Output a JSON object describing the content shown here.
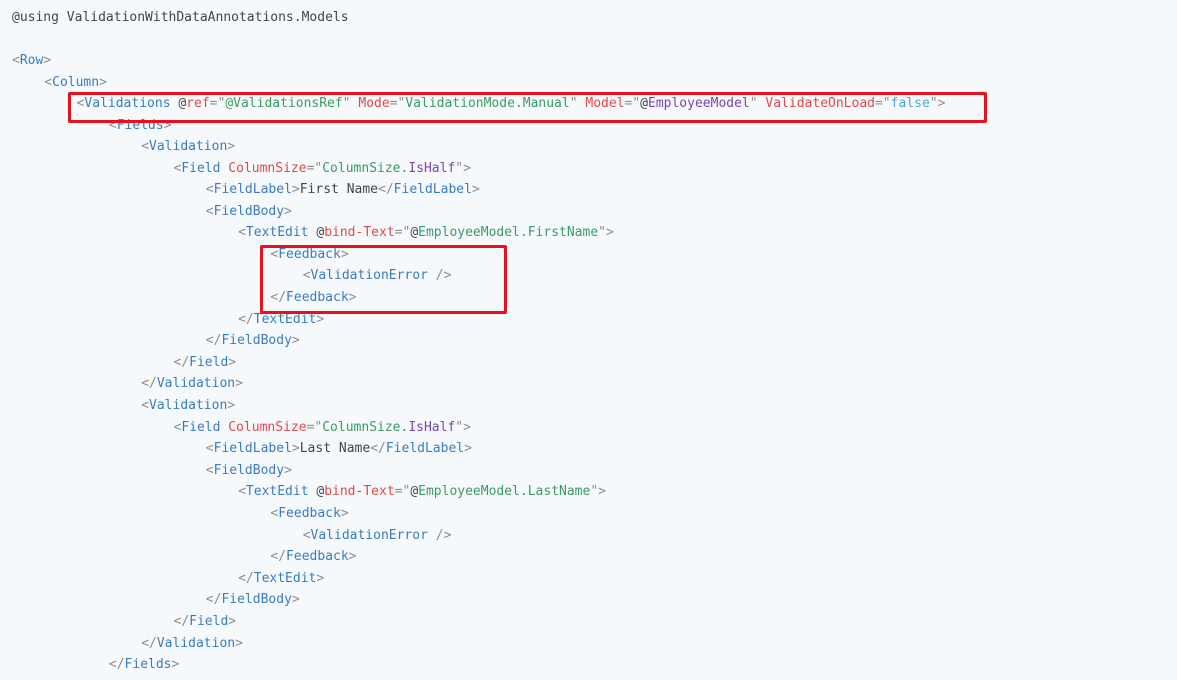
{
  "code_lines": [
    {
      "indent": 0,
      "tokens": [
        {
          "t": "text",
          "v": "@using ValidationWithDataAnnotations.Models"
        }
      ]
    },
    {
      "indent": 0,
      "tokens": []
    },
    {
      "indent": 0,
      "tokens": [
        {
          "t": "punct",
          "v": "<"
        },
        {
          "t": "tag",
          "v": "Row"
        },
        {
          "t": "punct",
          "v": ">"
        }
      ]
    },
    {
      "indent": 1,
      "tokens": [
        {
          "t": "punct",
          "v": "<"
        },
        {
          "t": "tag",
          "v": "Column"
        },
        {
          "t": "punct",
          "v": ">"
        }
      ]
    },
    {
      "indent": 2,
      "tokens": [
        {
          "t": "punct",
          "v": "<"
        },
        {
          "t": "tag",
          "v": "Validations"
        },
        {
          "t": "text",
          "v": " @"
        },
        {
          "t": "attr",
          "v": "ref"
        },
        {
          "t": "punct",
          "v": "=\""
        },
        {
          "t": "str",
          "v": "@ValidationsRef"
        },
        {
          "t": "punct",
          "v": "\""
        },
        {
          "t": "text",
          "v": " "
        },
        {
          "t": "attr",
          "v": "Mode"
        },
        {
          "t": "punct",
          "v": "=\""
        },
        {
          "t": "str",
          "v": "ValidationMode.Manual"
        },
        {
          "t": "punct",
          "v": "\""
        },
        {
          "t": "text",
          "v": " "
        },
        {
          "t": "attr",
          "v": "Model"
        },
        {
          "t": "punct",
          "v": "=\""
        },
        {
          "t": "text",
          "v": "@"
        },
        {
          "t": "val",
          "v": "EmployeeModel"
        },
        {
          "t": "punct",
          "v": "\""
        },
        {
          "t": "text",
          "v": " "
        },
        {
          "t": "attr",
          "v": "ValidateOnLoad"
        },
        {
          "t": "punct",
          "v": "=\""
        },
        {
          "t": "kw",
          "v": "false"
        },
        {
          "t": "punct",
          "v": "\">"
        }
      ]
    },
    {
      "indent": 3,
      "tokens": [
        {
          "t": "punct",
          "v": "<"
        },
        {
          "t": "tag",
          "v": "Fields"
        },
        {
          "t": "punct",
          "v": ">"
        }
      ]
    },
    {
      "indent": 4,
      "tokens": [
        {
          "t": "punct",
          "v": "<"
        },
        {
          "t": "tag",
          "v": "Validation"
        },
        {
          "t": "punct",
          "v": ">"
        }
      ]
    },
    {
      "indent": 5,
      "tokens": [
        {
          "t": "punct",
          "v": "<"
        },
        {
          "t": "tag",
          "v": "Field"
        },
        {
          "t": "text",
          "v": " "
        },
        {
          "t": "attr",
          "v": "ColumnSize"
        },
        {
          "t": "punct",
          "v": "=\""
        },
        {
          "t": "str",
          "v": "ColumnSize."
        },
        {
          "t": "val",
          "v": "IsHalf"
        },
        {
          "t": "punct",
          "v": "\">"
        }
      ]
    },
    {
      "indent": 6,
      "tokens": [
        {
          "t": "punct",
          "v": "<"
        },
        {
          "t": "tag",
          "v": "FieldLabel"
        },
        {
          "t": "punct",
          "v": ">"
        },
        {
          "t": "text",
          "v": "First Name"
        },
        {
          "t": "punct",
          "v": "</"
        },
        {
          "t": "tag",
          "v": "FieldLabel"
        },
        {
          "t": "punct",
          "v": ">"
        }
      ]
    },
    {
      "indent": 6,
      "tokens": [
        {
          "t": "punct",
          "v": "<"
        },
        {
          "t": "tag",
          "v": "FieldBody"
        },
        {
          "t": "punct",
          "v": ">"
        }
      ]
    },
    {
      "indent": 7,
      "tokens": [
        {
          "t": "punct",
          "v": "<"
        },
        {
          "t": "tag",
          "v": "TextEdit"
        },
        {
          "t": "text",
          "v": " @"
        },
        {
          "t": "attr",
          "v": "bind-Text"
        },
        {
          "t": "punct",
          "v": "=\""
        },
        {
          "t": "text",
          "v": "@"
        },
        {
          "t": "str",
          "v": "EmployeeModel.FirstName"
        },
        {
          "t": "punct",
          "v": "\">"
        }
      ]
    },
    {
      "indent": 8,
      "tokens": [
        {
          "t": "punct",
          "v": "<"
        },
        {
          "t": "tag",
          "v": "Feedback"
        },
        {
          "t": "punct",
          "v": ">"
        }
      ]
    },
    {
      "indent": 9,
      "tokens": [
        {
          "t": "punct",
          "v": "<"
        },
        {
          "t": "tag",
          "v": "ValidationError"
        },
        {
          "t": "punct",
          "v": " />"
        }
      ]
    },
    {
      "indent": 8,
      "tokens": [
        {
          "t": "punct",
          "v": "</"
        },
        {
          "t": "tag",
          "v": "Feedback"
        },
        {
          "t": "punct",
          "v": ">"
        }
      ]
    },
    {
      "indent": 7,
      "tokens": [
        {
          "t": "punct",
          "v": "</"
        },
        {
          "t": "tag",
          "v": "TextEdit"
        },
        {
          "t": "punct",
          "v": ">"
        }
      ]
    },
    {
      "indent": 6,
      "tokens": [
        {
          "t": "punct",
          "v": "</"
        },
        {
          "t": "tag",
          "v": "FieldBody"
        },
        {
          "t": "punct",
          "v": ">"
        }
      ]
    },
    {
      "indent": 5,
      "tokens": [
        {
          "t": "punct",
          "v": "</"
        },
        {
          "t": "tag",
          "v": "Field"
        },
        {
          "t": "punct",
          "v": ">"
        }
      ]
    },
    {
      "indent": 4,
      "tokens": [
        {
          "t": "punct",
          "v": "</"
        },
        {
          "t": "tag",
          "v": "Validation"
        },
        {
          "t": "punct",
          "v": ">"
        }
      ]
    },
    {
      "indent": 4,
      "tokens": [
        {
          "t": "punct",
          "v": "<"
        },
        {
          "t": "tag",
          "v": "Validation"
        },
        {
          "t": "punct",
          "v": ">"
        }
      ]
    },
    {
      "indent": 5,
      "tokens": [
        {
          "t": "punct",
          "v": "<"
        },
        {
          "t": "tag",
          "v": "Field"
        },
        {
          "t": "text",
          "v": " "
        },
        {
          "t": "attr",
          "v": "ColumnSize"
        },
        {
          "t": "punct",
          "v": "=\""
        },
        {
          "t": "str",
          "v": "ColumnSize."
        },
        {
          "t": "val",
          "v": "IsHalf"
        },
        {
          "t": "punct",
          "v": "\">"
        }
      ]
    },
    {
      "indent": 6,
      "tokens": [
        {
          "t": "punct",
          "v": "<"
        },
        {
          "t": "tag",
          "v": "FieldLabel"
        },
        {
          "t": "punct",
          "v": ">"
        },
        {
          "t": "text",
          "v": "Last Name"
        },
        {
          "t": "punct",
          "v": "</"
        },
        {
          "t": "tag",
          "v": "FieldLabel"
        },
        {
          "t": "punct",
          "v": ">"
        }
      ]
    },
    {
      "indent": 6,
      "tokens": [
        {
          "t": "punct",
          "v": "<"
        },
        {
          "t": "tag",
          "v": "FieldBody"
        },
        {
          "t": "punct",
          "v": ">"
        }
      ]
    },
    {
      "indent": 7,
      "tokens": [
        {
          "t": "punct",
          "v": "<"
        },
        {
          "t": "tag",
          "v": "TextEdit"
        },
        {
          "t": "text",
          "v": " @"
        },
        {
          "t": "attr",
          "v": "bind-Text"
        },
        {
          "t": "punct",
          "v": "=\""
        },
        {
          "t": "text",
          "v": "@"
        },
        {
          "t": "str",
          "v": "EmployeeModel.LastName"
        },
        {
          "t": "punct",
          "v": "\">"
        }
      ]
    },
    {
      "indent": 8,
      "tokens": [
        {
          "t": "punct",
          "v": "<"
        },
        {
          "t": "tag",
          "v": "Feedback"
        },
        {
          "t": "punct",
          "v": ">"
        }
      ]
    },
    {
      "indent": 9,
      "tokens": [
        {
          "t": "punct",
          "v": "<"
        },
        {
          "t": "tag",
          "v": "ValidationError"
        },
        {
          "t": "punct",
          "v": " />"
        }
      ]
    },
    {
      "indent": 8,
      "tokens": [
        {
          "t": "punct",
          "v": "</"
        },
        {
          "t": "tag",
          "v": "Feedback"
        },
        {
          "t": "punct",
          "v": ">"
        }
      ]
    },
    {
      "indent": 7,
      "tokens": [
        {
          "t": "punct",
          "v": "</"
        },
        {
          "t": "tag",
          "v": "TextEdit"
        },
        {
          "t": "punct",
          "v": ">"
        }
      ]
    },
    {
      "indent": 6,
      "tokens": [
        {
          "t": "punct",
          "v": "</"
        },
        {
          "t": "tag",
          "v": "FieldBody"
        },
        {
          "t": "punct",
          "v": ">"
        }
      ]
    },
    {
      "indent": 5,
      "tokens": [
        {
          "t": "punct",
          "v": "</"
        },
        {
          "t": "tag",
          "v": "Field"
        },
        {
          "t": "punct",
          "v": ">"
        }
      ]
    },
    {
      "indent": 4,
      "tokens": [
        {
          "t": "punct",
          "v": "</"
        },
        {
          "t": "tag",
          "v": "Validation"
        },
        {
          "t": "punct",
          "v": ">"
        }
      ]
    },
    {
      "indent": 3,
      "tokens": [
        {
          "t": "punct",
          "v": "</"
        },
        {
          "t": "tag",
          "v": "Fields"
        },
        {
          "t": "punct",
          "v": ">"
        }
      ]
    }
  ],
  "highlights": [
    {
      "name": "validations-highlight-box",
      "color": "#e8101a"
    },
    {
      "name": "feedback-highlight-box",
      "color": "#e8101a"
    }
  ],
  "colors": {
    "background": "#f6f9fc",
    "text": "#444444",
    "punctuation": "#8c8c8c",
    "tag": "#3a7bc0",
    "attribute": "#e44848",
    "string": "#3c9a63",
    "value": "#7b45b0",
    "keyword": "#4aa6d6",
    "highlight": "#e8101a"
  }
}
